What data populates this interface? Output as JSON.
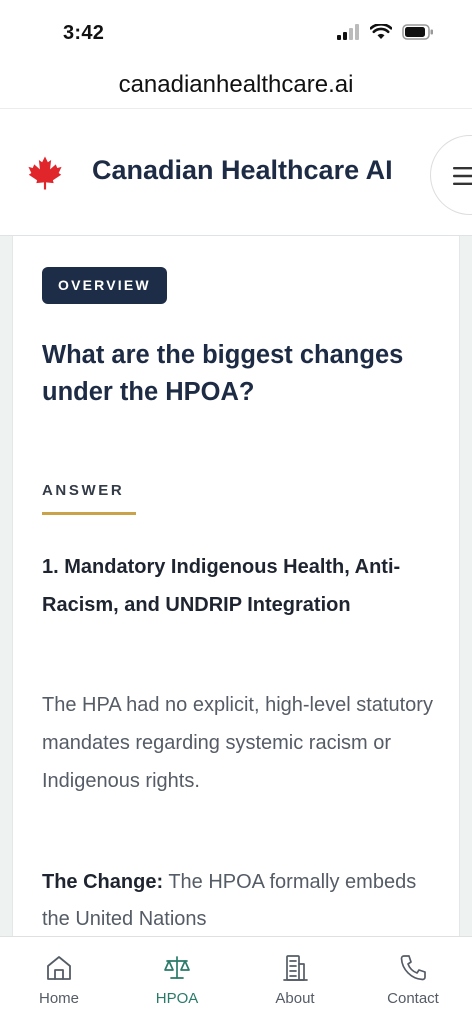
{
  "status_bar": {
    "time": "3:42"
  },
  "browser": {
    "url": "canadianhealthcare.ai"
  },
  "header": {
    "brand_name": "Canadian Healthcare AI",
    "logo_icon": "maple-leaf-icon",
    "menu_icon": "hamburger-menu-icon"
  },
  "content": {
    "badge": "OVERVIEW",
    "question": "What are the biggest changes under the HPOA?",
    "answer_label": "ANSWER",
    "section_heading": "1. Mandatory Indigenous Health, Anti-Racism, and UNDRIP Integration",
    "paragraph": "The HPA had no explicit, high-level statutory mandates regarding systemic racism or Indigenous rights.",
    "change_label": "The Change:",
    "change_text": " The HPOA formally embeds the United Nations"
  },
  "bottom_nav": {
    "items": [
      {
        "label": "Home",
        "icon": "home-icon",
        "active": false
      },
      {
        "label": "HPOA",
        "icon": "scales-icon",
        "active": true
      },
      {
        "label": "About",
        "icon": "building-icon",
        "active": false
      },
      {
        "label": "Contact",
        "icon": "phone-icon",
        "active": false
      }
    ]
  },
  "colors": {
    "brand_navy": "#1d2d48",
    "accent_gold": "#c9a24a",
    "nav_active": "#2a7a6a",
    "maple_red": "#e0262b"
  }
}
